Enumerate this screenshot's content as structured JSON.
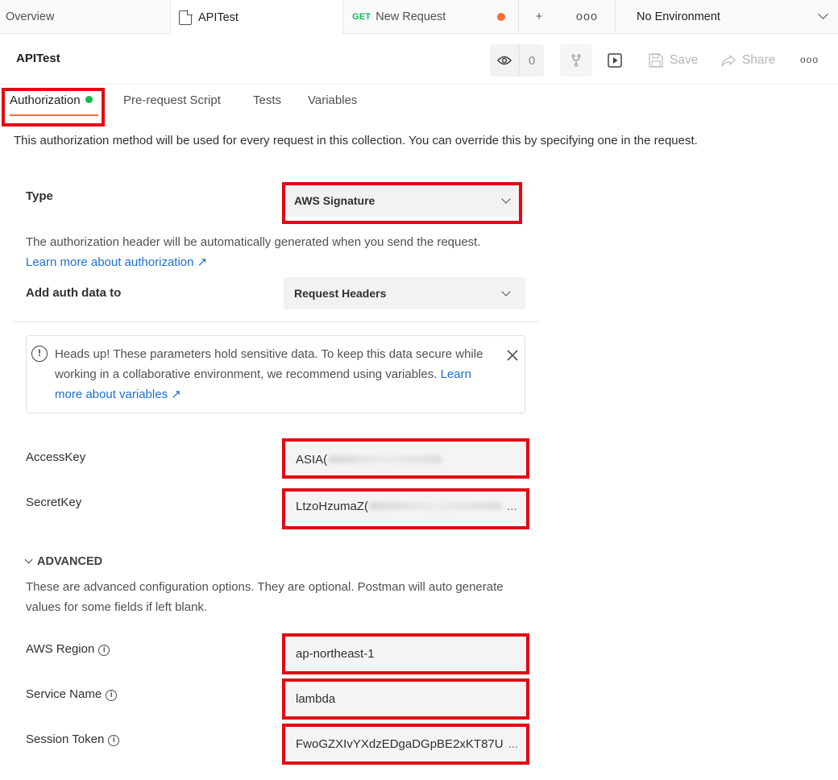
{
  "tabs": {
    "overview": "Overview",
    "collection": "APITest",
    "request_method": "GET",
    "request_name": "New Request",
    "plus": "+",
    "more": "ooo",
    "environment": "No Environment"
  },
  "header": {
    "title": "APITest",
    "watch_count": "0",
    "save_label": "Save",
    "share_label": "Share",
    "more": "ooo"
  },
  "subtabs": [
    "Authorization",
    "Pre-request Script",
    "Tests",
    "Variables"
  ],
  "description": "This authorization method will be used for every request in this collection. You can override this by specifying one in the request.",
  "auth": {
    "type_label": "Type",
    "type_value": "AWS Signature",
    "header_note": "The authorization header will be automatically generated when you send the request.",
    "learn_more_link": "Learn more about authorization ↗",
    "add_to_label": "Add auth data to",
    "add_to_value": "Request Headers"
  },
  "alert": {
    "icon": "!",
    "text": "Heads up! These parameters hold sensitive data. To keep this data secure while working in a collaborative environment, we recommend using variables.",
    "link": "Learn more about variables ↗"
  },
  "fields": {
    "access_key_label": "AccessKey",
    "access_key_value": "ASIA(",
    "secret_key_label": "SecretKey",
    "secret_key_value": "LtzoHzumaZ(",
    "secret_key_ellipsis": "...",
    "advanced_title": "ADVANCED",
    "advanced_note": "These are advanced configuration options. They are optional. Postman will auto generate values for some fields if left blank.",
    "region_label": "AWS Region",
    "region_value": "ap-northeast-1",
    "service_label": "Service Name",
    "service_value": "lambda",
    "token_label": "Session Token",
    "token_value": "FwoGZXIvYXdzEDgaDGpBE2xKT87U",
    "token_ellipsis": "..."
  },
  "colors": {
    "accent": "#ff6c37",
    "success": "#0cbb52",
    "link": "#1f6fd1",
    "highlight_box": "#e30613"
  }
}
